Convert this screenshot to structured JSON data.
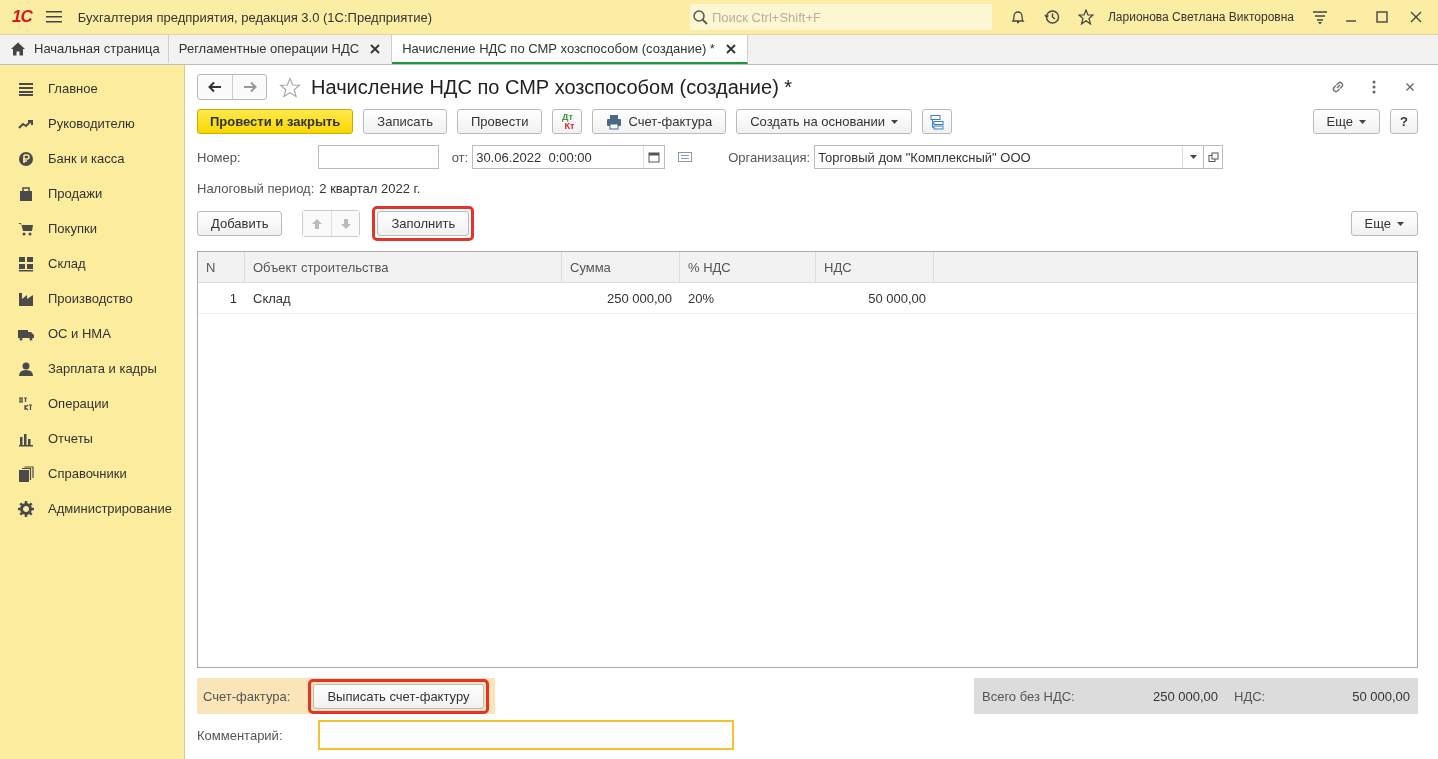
{
  "app_bar": {
    "logo": "1С",
    "title": "Бухгалтерия предприятия, редакция 3.0  (1С:Предприятие)",
    "search": {
      "placeholder": "Поиск Ctrl+Shift+F"
    },
    "user": "Ларионова Светлана Викторовна"
  },
  "tabs": [
    {
      "label": "Начальная страница",
      "kind": "home",
      "selected": false
    },
    {
      "label": "Регламентные операции НДС",
      "kind": "closable",
      "selected": false
    },
    {
      "label": "Начисление НДС по СМР хозспособом (создание) *",
      "kind": "closable",
      "selected": true
    }
  ],
  "sidebar": {
    "items": [
      {
        "label": "Главное"
      },
      {
        "label": "Руководителю"
      },
      {
        "label": "Банк и касса"
      },
      {
        "label": "Продажи"
      },
      {
        "label": "Покупки"
      },
      {
        "label": "Склад"
      },
      {
        "label": "Производство"
      },
      {
        "label": "ОС и НМА"
      },
      {
        "label": "Зарплата и кадры"
      },
      {
        "label": "Операции"
      },
      {
        "label": "Отчеты"
      },
      {
        "label": "Справочники"
      },
      {
        "label": "Администрирование"
      }
    ]
  },
  "form": {
    "title": "Начисление НДС по СМР хозспособом (создание) *",
    "toolbar": [
      {
        "kind": "primary",
        "label": "Провести и закрыть"
      },
      {
        "kind": "plain",
        "label": "Записать"
      },
      {
        "kind": "plain",
        "label": "Провести"
      },
      {
        "kind": "dtkt",
        "icon_text": [
          "Дт",
          "Кт"
        ]
      },
      {
        "kind": "print",
        "label": "Счет-фактура"
      },
      {
        "kind": "dropdown",
        "label": "Создать на основании"
      },
      {
        "kind": "structure"
      }
    ],
    "more_button": "Еще",
    "help_button": "?",
    "number_label": "Номер:",
    "date_label": "от:",
    "date_value": "30.06.2022  0:00:00",
    "org_label": "Организация:",
    "org_value": "Торговый дом \"Комплексный\" ООО",
    "period_label": "Налоговый период:",
    "period_value": "2 квартал 2022 г.",
    "table_toolbar": {
      "add": "Добавить",
      "fill": {
        "label": "Заполнить",
        "highlighted": true
      },
      "more": "Еще"
    },
    "table": {
      "columns": [
        "N",
        "Объект строительства",
        "Сумма",
        "% НДС",
        "НДС"
      ],
      "rows": [
        {
          "n": "1",
          "object": "Склад",
          "sum": "250 000,00",
          "rate": "20%",
          "vat": "50 000,00"
        }
      ]
    },
    "invoice_label": "Счет-фактура:",
    "invoice_button": {
      "label": "Выписать счет-фактуру",
      "highlighted": true
    },
    "total_label": "Всего без НДС:",
    "total_value": "250 000,00",
    "vat_label": "НДС:",
    "vat_value": "50 000,00",
    "comment_label": "Комментарий:"
  }
}
